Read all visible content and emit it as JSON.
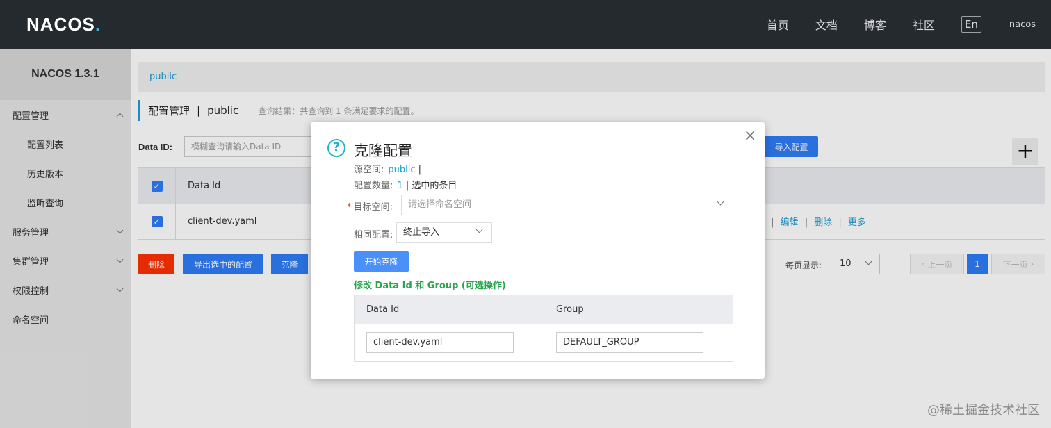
{
  "header": {
    "logo_text": "NACOS",
    "logo_dot": ".",
    "nav": [
      "首页",
      "文档",
      "博客",
      "社区"
    ],
    "lang_button": "En",
    "user": "nacos"
  },
  "sidebar": {
    "title": "NACOS 1.3.1",
    "items": [
      {
        "label": "配置管理",
        "chevron": "up"
      },
      {
        "label": "配置列表",
        "sub": true
      },
      {
        "label": "历史版本",
        "sub": true
      },
      {
        "label": "监听查询",
        "sub": true
      },
      {
        "label": "服务管理",
        "chevron": "down"
      },
      {
        "label": "集群管理",
        "chevron": "down"
      },
      {
        "label": "权限控制",
        "chevron": "down"
      },
      {
        "label": "命名空间"
      }
    ]
  },
  "main": {
    "breadcrumb": "public",
    "page_title": "配置管理",
    "page_sep": "|",
    "page_ns": "public",
    "query_hint": "查询结果：共查询到 1 条满足要求的配置。",
    "search_label": "Data ID:",
    "search_placeholder": "模糊查询请输入Data ID",
    "import_button": "导入配置",
    "plus_button": "+",
    "table_header": "Data Id",
    "row_data_id": "client-dev.yaml",
    "row_ops": [
      "编辑",
      "删除",
      "更多"
    ],
    "op_sep": "|",
    "delete_button": "删除",
    "export_button": "导出选中的配置",
    "clone_button": "克隆",
    "page_size_label": "每页显示:",
    "page_size": "10",
    "prev_page": "上一页",
    "current_page": "1",
    "next_page": "下一页"
  },
  "dialog": {
    "title": "克隆配置",
    "source_label": "源空间:",
    "source_value": "public",
    "source_sep": "|",
    "count_label": "配置数量:",
    "count_value": "1",
    "count_suffix": "| 选中的条目",
    "target_label": "目标空间:",
    "target_placeholder": "请选择命名空间",
    "same_label": "相同配置:",
    "same_value": "终止导入",
    "start_button": "开始克隆",
    "modify_note": "修改 Data Id 和 Group (可选操作)",
    "table": {
      "col_data_id": "Data Id",
      "col_group": "Group",
      "data_id_value": "client-dev.yaml",
      "group_value": "DEFAULT_GROUP"
    }
  },
  "watermark": "@稀土掘金技术社区",
  "colors": {
    "accent": "#2e7cf6",
    "danger": "#ff3000",
    "link": "#1a9fd5",
    "topbar": "#252a2f"
  }
}
